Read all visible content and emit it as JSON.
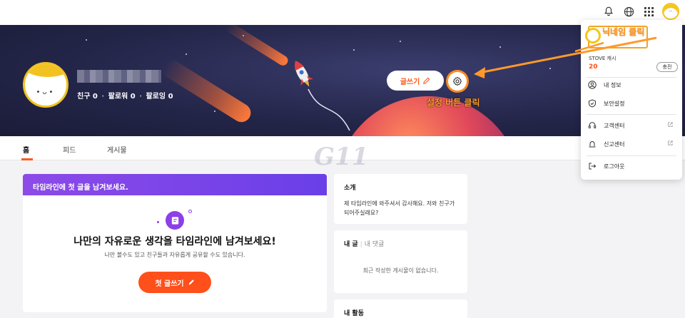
{
  "header": {
    "icons": [
      "bell-icon",
      "globe-icon",
      "apps-grid-icon",
      "user-avatar"
    ]
  },
  "profile": {
    "stats": {
      "friends_label": "친구",
      "friends_count": "0",
      "followers_label": "팔로워",
      "followers_count": "0",
      "following_label": "팔로잉",
      "following_count": "0"
    },
    "write_button": "글쓰기",
    "settings_annotation": "설정 버튼 클릭"
  },
  "tabs": [
    {
      "label": "홈",
      "active": true
    },
    {
      "label": "피드",
      "active": false
    },
    {
      "label": "게시물",
      "active": false
    }
  ],
  "timeline": {
    "banner": "타임라인에 첫 글을 남겨보세요.",
    "title": "나만의 자유로운 생각을 타임라인에 남겨보세요!",
    "subtitle": "나만 볼수도 있고 친구들과 자유롭게 공유할 수도 있습니다.",
    "button": "첫 글쓰기"
  },
  "about": {
    "title": "소개",
    "text": "제 타임라인에 와주셔서 감사해요. 저와 친구가 되어주실래요?"
  },
  "posts": {
    "tab_posts": "내 글",
    "tab_comments": "내 댓글",
    "empty": "최근 작성한 게시물이 없습니다."
  },
  "activity": {
    "title": "내 활동"
  },
  "menu": {
    "nickname_annotation": "닉네임 클릭",
    "cash_label": "STOVE 캐시",
    "cash_value": "20",
    "charge_button": "충전",
    "items": [
      {
        "label": "내 정보",
        "icon": "user-circle-icon"
      },
      {
        "label": "보안설정",
        "icon": "shield-icon"
      },
      {
        "label": "고객센터",
        "icon": "headset-icon"
      },
      {
        "label": "신고센터",
        "icon": "siren-icon"
      },
      {
        "label": "로그아웃",
        "icon": "logout-icon"
      }
    ]
  },
  "colors": {
    "accent": "#ff5a1f",
    "annotation": "#ff9a2a",
    "timeline_banner": "#7b45e8"
  }
}
